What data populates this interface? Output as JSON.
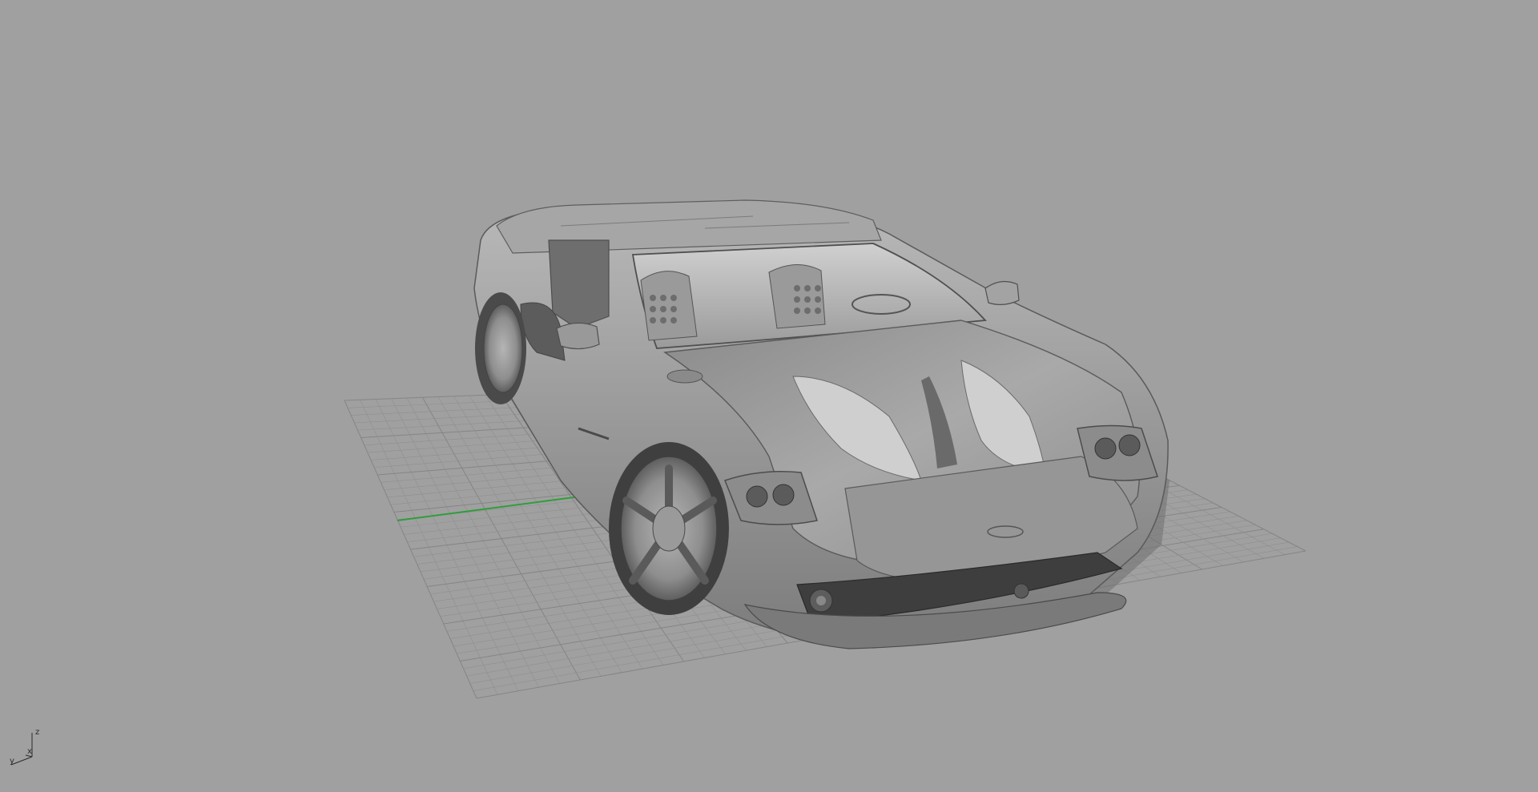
{
  "viewport": {
    "background_color": "#a0a0a0",
    "grid_color": "#8f8f8f",
    "grid_major_color": "#858585",
    "x_axis_color": "#2f9e3a",
    "model": "car-model",
    "shading": "shaded-gray"
  },
  "axis_widget": {
    "z_label": "z",
    "x_label": "x",
    "y_label": "y"
  }
}
